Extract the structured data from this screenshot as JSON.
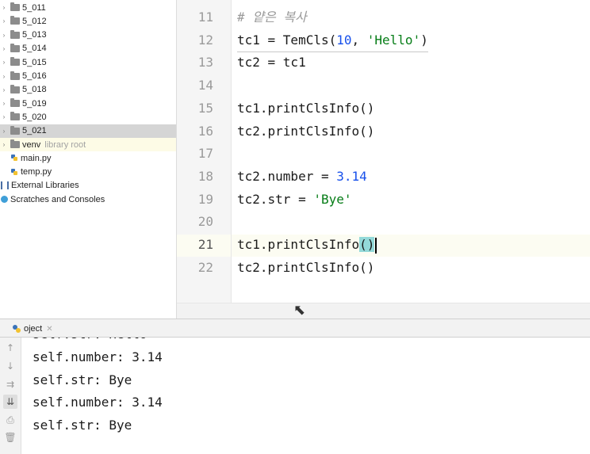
{
  "project_tree": {
    "folders": [
      "5_011",
      "5_012",
      "5_013",
      "5_014",
      "5_015",
      "5_016",
      "5_018",
      "5_019",
      "5_020",
      "5_021"
    ],
    "selected_folder": "5_021",
    "venv": {
      "label": "venv",
      "hint": "library root"
    },
    "files": [
      "main.py",
      "temp.py"
    ],
    "external_libraries": "External Libraries",
    "scratches": "Scratches and Consoles"
  },
  "editor": {
    "current_line": 21,
    "lines": [
      {
        "n": "11",
        "parts": [
          {
            "t": "# 얕은 복사",
            "c": "comment"
          }
        ]
      },
      {
        "n": "12",
        "parts": [
          {
            "t": "tc1 = TemCls("
          },
          {
            "t": "10",
            "c": "num"
          },
          {
            "t": ", "
          },
          {
            "t": "'Hello'",
            "c": "str"
          },
          {
            "t": ")"
          }
        ]
      },
      {
        "n": "13",
        "parts": [
          {
            "t": "tc2 = tc1"
          }
        ]
      },
      {
        "n": "14",
        "parts": []
      },
      {
        "n": "15",
        "parts": [
          {
            "t": "tc1.printClsInfo()"
          }
        ]
      },
      {
        "n": "16",
        "parts": [
          {
            "t": "tc2.printClsInfo()"
          }
        ]
      },
      {
        "n": "17",
        "parts": []
      },
      {
        "n": "18",
        "parts": [
          {
            "t": "tc2.number = "
          },
          {
            "t": "3.14",
            "c": "num"
          }
        ]
      },
      {
        "n": "19",
        "parts": [
          {
            "t": "tc2.str = "
          },
          {
            "t": "'Bye'",
            "c": "str"
          }
        ]
      },
      {
        "n": "20",
        "parts": []
      },
      {
        "n": "21",
        "parts": [
          {
            "t": "tc1.printClsInfo"
          },
          {
            "t": "()",
            "c": "brace"
          },
          {
            "t": "",
            "c": "caret"
          }
        ]
      },
      {
        "n": "22",
        "parts": [
          {
            "t": "tc2.printClsInfo()"
          }
        ]
      }
    ]
  },
  "run_panel": {
    "tab_label": "oject",
    "output_partial": "self.str: Hello",
    "output": [
      "self.number: 3.14",
      "self.str: Bye",
      "self.number: 3.14",
      "self.str: Bye"
    ],
    "tools": [
      "up-arrow-icon",
      "down-arrow-icon",
      "soft-wrap-icon",
      "scroll-to-end-icon",
      "print-icon",
      "trash-icon"
    ]
  },
  "colors": {
    "keyword_number": "#1750eb",
    "string": "#067d17",
    "comment": "#9a9a9a",
    "brace_match": "#93d9d9"
  }
}
